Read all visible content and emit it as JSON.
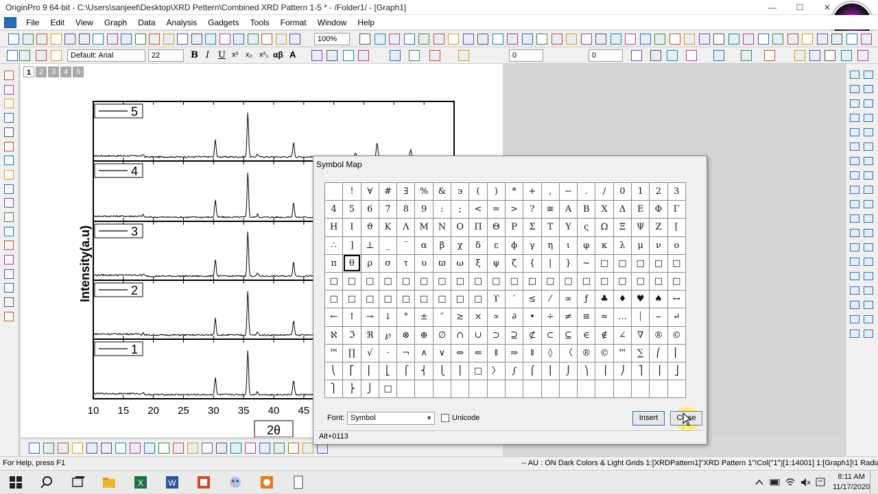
{
  "window": {
    "title": "OriginPro 9 64-bit - C:\\Users\\sanjeet\\Desktop\\XRD Pettern\\Combined XRD Pattern 1-5 * - /Folder1/ - [Graph1]"
  },
  "menu": [
    "File",
    "Edit",
    "View",
    "Graph",
    "Data",
    "Analysis",
    "Gadgets",
    "Tools",
    "Format",
    "Window",
    "Help"
  ],
  "toolbar": {
    "zoom": "100%",
    "font": "Default: Arial",
    "font_size": "22",
    "text_buttons": [
      "B",
      "I",
      "U",
      "x²",
      "x₂",
      "x²₁",
      "αβ",
      "A"
    ],
    "line_width": "0",
    "line_width2": "0"
  },
  "page_tabs": [
    "1",
    "2",
    "3",
    "4",
    "5"
  ],
  "graph": {
    "ylabel": "Intensity(a.u)",
    "xlabel": "2θ",
    "legend": [
      "5",
      "4",
      "3",
      "2",
      "1"
    ],
    "xticks": [
      "10",
      "15",
      "20",
      "25",
      "30",
      "35",
      "40",
      "45"
    ]
  },
  "chart_data": {
    "type": "line",
    "title": "",
    "xlabel": "2θ",
    "ylabel": "Intensity(a.u)",
    "xlim": [
      10,
      70
    ],
    "visible_xticks": [
      10,
      15,
      20,
      25,
      30,
      35,
      40,
      45
    ],
    "series": [
      {
        "name": "5"
      },
      {
        "name": "4"
      },
      {
        "name": "3"
      },
      {
        "name": "2"
      },
      {
        "name": "1"
      }
    ],
    "peaks_2theta": [
      18.3,
      30.3,
      35.7,
      37.3,
      43.3
    ]
  },
  "dialog": {
    "title": "Symbol Map",
    "font_label": "Font:",
    "font_value": "Symbol",
    "unicode_label": "Unicode",
    "insert_label": "Insert",
    "close_label": "Close",
    "status": "Alt+0113"
  },
  "symbols": [
    [
      " ",
      "!",
      "∀",
      "#",
      "∃",
      "%",
      "&",
      "϶",
      "(",
      ")",
      "*",
      "+",
      ",",
      "−",
      ".",
      "/",
      "0",
      "1",
      "2",
      "3"
    ],
    [
      "4",
      "5",
      "6",
      "7",
      "8",
      "9",
      ":",
      ";",
      "<",
      "=",
      ">",
      "?",
      "≅",
      "Α",
      "Β",
      "Χ",
      "Δ",
      "Ε",
      "Φ",
      "Γ"
    ],
    [
      "Η",
      "Ι",
      "ϑ",
      "Κ",
      "Λ",
      "Μ",
      "Ν",
      "Ο",
      "Π",
      "Θ",
      "Ρ",
      "Σ",
      "Τ",
      "Υ",
      "ς",
      "Ω",
      "Ξ",
      "Ψ",
      "Ζ",
      "["
    ],
    [
      "∴",
      "]",
      "⊥",
      "_",
      "‾",
      "α",
      "β",
      "χ",
      "δ",
      "ε",
      "ϕ",
      "γ",
      "η",
      "ι",
      "φ",
      "κ",
      "λ",
      "μ",
      "ν",
      "ο"
    ],
    [
      "π",
      "θ",
      "ρ",
      "σ",
      "τ",
      "υ",
      "ϖ",
      "ω",
      "ξ",
      "ψ",
      "ζ",
      "{",
      "|",
      "}",
      "~",
      "□",
      "□",
      "□",
      "□",
      "□"
    ],
    [
      "□",
      "□",
      "□",
      "□",
      "□",
      "□",
      "□",
      "□",
      "□",
      "□",
      "□",
      "□",
      "□",
      "□",
      "□",
      "□",
      "□",
      "□",
      "□",
      "□"
    ],
    [
      "□",
      "□",
      "□",
      "□",
      "□",
      "□",
      "□",
      "□",
      "□",
      "ϒ",
      "′",
      "≤",
      "⁄",
      "∞",
      "ƒ",
      "♣",
      "♦",
      "♥",
      "♠",
      "↔"
    ],
    [
      "←",
      "↑",
      "→",
      "↓",
      "°",
      "±",
      "″",
      "≥",
      "×",
      "∝",
      "∂",
      "•",
      "÷",
      "≠",
      "≡",
      "≈",
      "…",
      "⏐",
      "⎯",
      "↵"
    ],
    [
      "ℵ",
      "ℑ",
      "ℜ",
      "℘",
      "⊗",
      "⊕",
      "∅",
      "∩",
      "∪",
      "⊃",
      "⊇",
      "⊄",
      "⊂",
      "⊆",
      "∈",
      "∉",
      "∠",
      "∇",
      "®",
      "©"
    ],
    [
      "™",
      "∏",
      "√",
      "⋅",
      "¬",
      "∧",
      "∨",
      "⇔",
      "⇐",
      "⇑",
      "⇒",
      "⇓",
      "◊",
      "〈",
      "®",
      "©",
      "™",
      "∑",
      "⎛",
      "⎜"
    ],
    [
      "⎝",
      "⎡",
      "⎢",
      "⎣",
      "⎧",
      "⎨",
      "⎩",
      "⎪",
      "□",
      "〉",
      "∫",
      "⌠",
      "⎮",
      "⌡",
      "⎞",
      "⎟",
      "⎠",
      "⎤",
      "⎥",
      "⎦"
    ],
    [
      "⎫",
      "⎬",
      "⎭",
      "□",
      "",
      "",
      "",
      "",
      "",
      "",
      "",
      "",
      "",
      "",
      "",
      "",
      "",
      "",
      "",
      ""
    ]
  ],
  "selected": {
    "row": 4,
    "col": 1
  },
  "status": {
    "left": "For Help, press F1",
    "right": "-- AU : ON  Dark Colors & Light Grids  1:[XRDPattern1]\"XRD Pattern 1\"!Col(\"1\")[1:14001]  1:[Graph1]!1  Radian"
  },
  "clock": {
    "time": "8:11 AM",
    "date": "11/17/2020"
  }
}
